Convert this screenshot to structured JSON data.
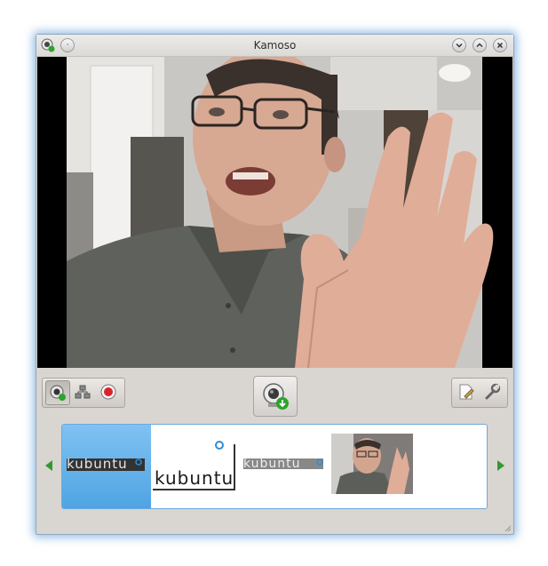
{
  "window": {
    "title": "Kamoso",
    "controls": [
      "minimize-icon",
      "maximize-icon",
      "close-icon"
    ]
  },
  "video": {
    "description_icon": "webcam-feed"
  },
  "toolbar": {
    "mode_buttons": [
      {
        "icon": "webcam-photo-icon",
        "active": true
      },
      {
        "icon": "burst-mode-icon",
        "active": false
      },
      {
        "icon": "record-video-icon",
        "active": false
      }
    ],
    "capture_icon": "webcam-capture-icon",
    "right_buttons": [
      {
        "icon": "edit-document-icon"
      },
      {
        "icon": "wrench-settings-icon"
      }
    ]
  },
  "thumbnails": {
    "items": [
      {
        "label": "kubuntu",
        "selected": true
      },
      {
        "label": "kubuntu",
        "selected": false
      },
      {
        "label": "kubuntu",
        "selected": false
      },
      {
        "label": "",
        "selected": false
      }
    ],
    "nav": [
      "arrow-left-icon",
      "arrow-right-icon"
    ]
  },
  "colors": {
    "accent": "#4fa4e3",
    "record": "#d9232b",
    "nav_arrow": "#2f9b2f",
    "capture_badge": "#2aa52a"
  }
}
